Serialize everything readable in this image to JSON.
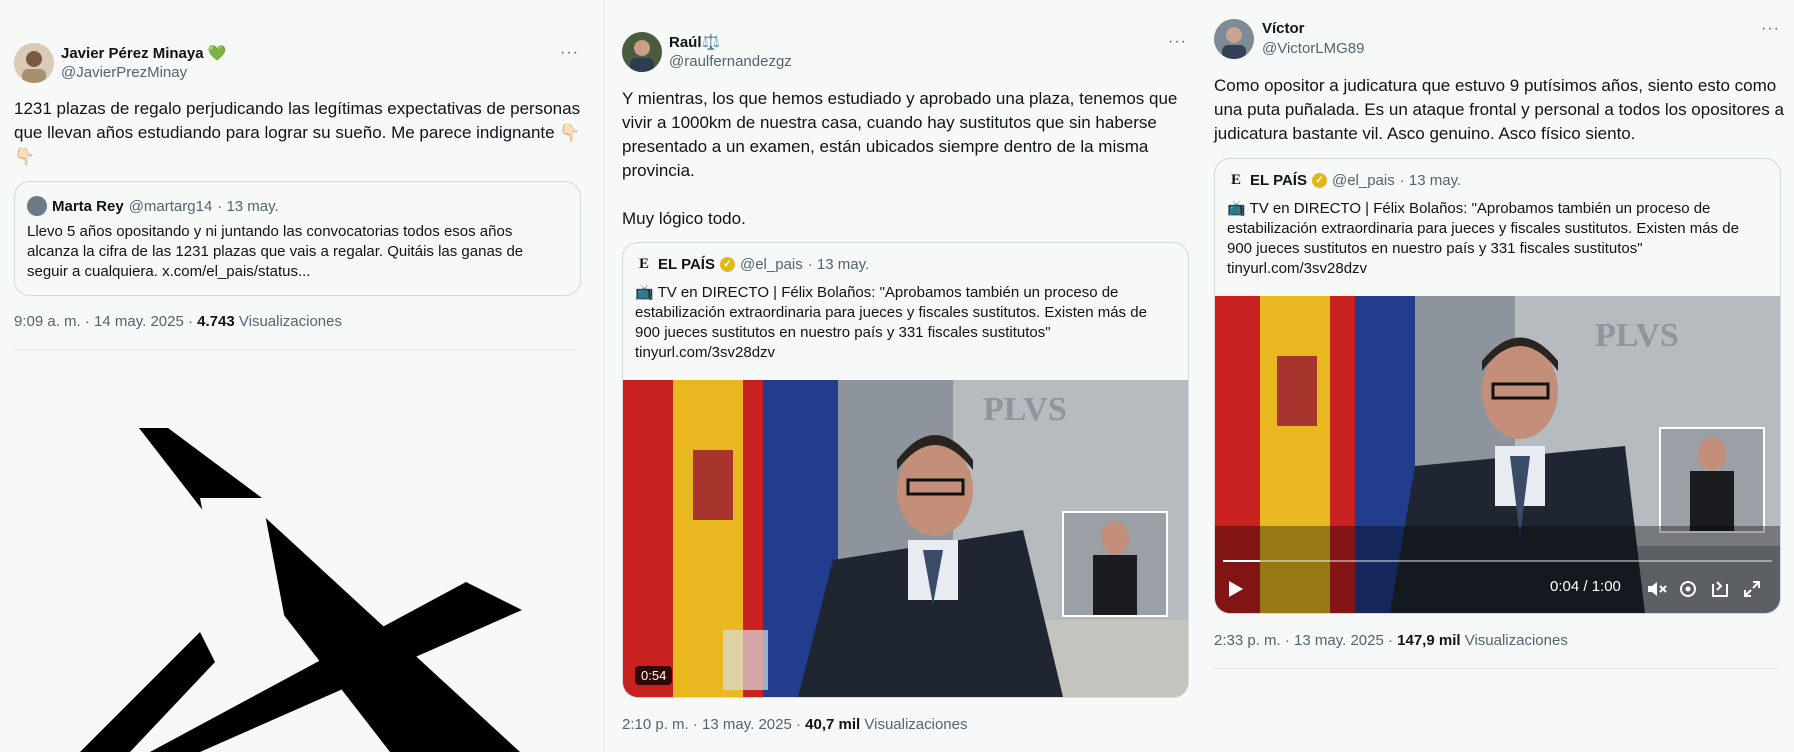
{
  "tweet1": {
    "name": "Javier Pérez Minaya",
    "name_emoji": "💚",
    "handle": "@JavierPrezMinay",
    "text": "1231 plazas de regalo perjudicando las legítimas expectativas de personas que llevan años estudiando para lograr su sueño. Me parece indignante 👇🏻👇🏻",
    "quote": {
      "name": "Marta Rey",
      "handle": "@martarg14",
      "date": "· 13 may.",
      "text": "Llevo 5 años opositando y ni juntando las convocatorias todos esos años alcanza la cifra de las 1231 plazas que vais a regalar. Quitáis las ganas de seguir a cualquiera. x.com/el_pais/status..."
    },
    "time": "9:09 a. m. · 14 may. 2025 · ",
    "views_count": "4.743",
    "views_label": "Visualizaciones"
  },
  "tweet2": {
    "name": "Raúl",
    "name_emoji": "⚖️",
    "handle": "@raulfernandezgz",
    "text_p1": "Y mientras, los que hemos estudiado y aprobado una plaza, tenemos que vivir a 1000km de nuestra casa, cuando hay sustitutos que sin haberse presentado a un examen, están ubicados siempre dentro de la misma provincia.",
    "text_p2": "Muy lógico todo.",
    "quote": {
      "logo": "E",
      "name": "EL PAÍS",
      "handle": "@el_pais",
      "date": "· 13 may.",
      "text": "📺 TV en DIRECTO | Félix Bolaños: \"Aprobamos también un proceso de estabilización extraordinaria para jueces y fiscales sustitutos. Existen más de 900 jueces sustitutos en nuestro país y 331 fiscales sustitutos\" tinyurl.com/3sv28dzv"
    },
    "video_duration": "0:54",
    "time": "2:10 p. m. · 13 may. 2025 · ",
    "views_count": "40,7 mil",
    "views_label": "Visualizaciones"
  },
  "tweet3": {
    "name": "Víctor",
    "handle": "@VictorLMG89",
    "text": "Como opositor a judicatura que estuvo 9 putísimos años, siento esto como una puta puñalada. Es un ataque frontal y personal a todos los opositores a judicatura bastante vil. Asco genuino. Asco físico siento.",
    "quote": {
      "logo": "E",
      "name": "EL PAÍS",
      "handle": "@el_pais",
      "date": "· 13 may.",
      "text": "📺 TV en DIRECTO | Félix Bolaños: \"Aprobamos también un proceso de estabilización extraordinaria para jueces y fiscales sustitutos. Existen más de 900 jueces sustitutos en nuestro país y 331 fiscales sustitutos\" tinyurl.com/3sv28dzv"
    },
    "video_time": "0:04 / 1:00",
    "video_progress": 0.067,
    "time": "2:33 p. m. · 13 may. 2025 · ",
    "views_count": "147,9 mil",
    "views_label": "Visualizaciones"
  },
  "more_glyph": "···",
  "icons": [
    "x-logo-icon",
    "verified-gold-badge-icon",
    "play-icon",
    "mute-icon",
    "settings-icon",
    "dock-icon",
    "fullscreen-icon"
  ],
  "colors": {
    "text": "#0f1419",
    "muted": "#536471",
    "border": "#cfd9de",
    "background": "#f7f8f8",
    "badge": "#e2b719"
  }
}
